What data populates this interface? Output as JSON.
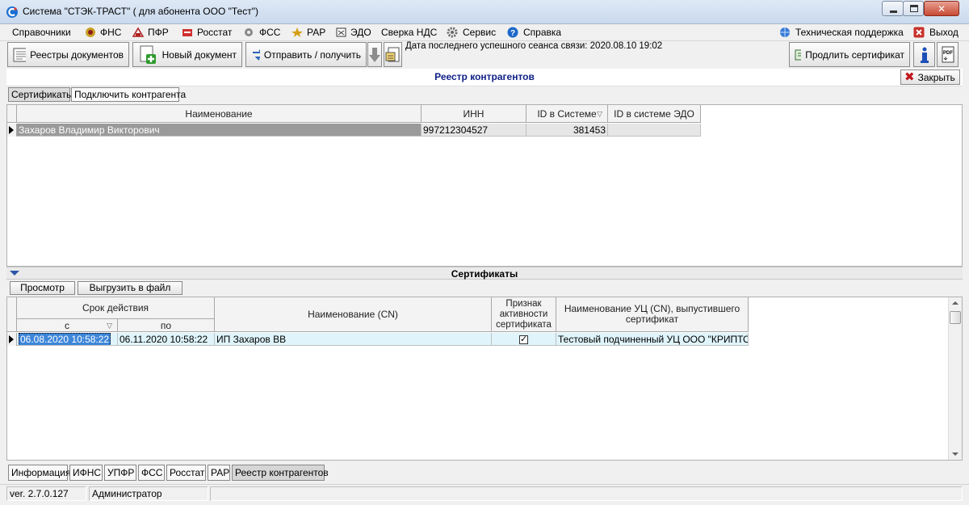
{
  "window": {
    "title": "Система \"СТЭК-ТРАСТ\" ( для абонента ООО \"Тест\")"
  },
  "menu": {
    "items": [
      {
        "label": "Справочники",
        "icon": "none"
      },
      {
        "label": "ФНС",
        "icon": "fns-icon"
      },
      {
        "label": "ПФР",
        "icon": "pfr-icon"
      },
      {
        "label": "Росстат",
        "icon": "rosstat-icon"
      },
      {
        "label": "ФСС",
        "icon": "fss-icon"
      },
      {
        "label": "РАР",
        "icon": "rar-icon"
      },
      {
        "label": "ЭДО",
        "icon": "edo-icon"
      },
      {
        "label": "Сверка НДС",
        "icon": "none"
      },
      {
        "label": "Сервис",
        "icon": "gear-icon"
      },
      {
        "label": "Справка",
        "icon": "help-icon"
      }
    ],
    "support": "Техническая поддержка",
    "exit": "Выход"
  },
  "toolbar": {
    "registry_label": "Реестры документов",
    "new_doc_label": "Новый документ",
    "send_receive_label": "Отправить / получить",
    "last_session": "Дата последнего успешного сеанса связи: 2020.08.10 19:02",
    "renew_cert_label": "Продлить сертификат"
  },
  "section": {
    "title": "Реестр контрагентов",
    "close_label": "Закрыть"
  },
  "subtabs": [
    "Сертификаты",
    "Подключить контрагента"
  ],
  "contractors": {
    "columns": [
      "Наименование",
      "ИНН",
      "ID в Системе",
      "ID в системе ЭДО"
    ],
    "rows": [
      {
        "name": "Захаров Владимир Викторович",
        "inn": "997212304527",
        "system_id": "381453",
        "edo_id": ""
      }
    ]
  },
  "certificates": {
    "title": "Сертификаты",
    "view_label": "Просмотр",
    "export_label": "Выгрузить в файл",
    "columns": {
      "validity": "Срок действия",
      "from": "с",
      "to": "по",
      "cn": "Наименование (CN)",
      "active": "Признак активности сертификата",
      "issuer": "Наименование УЦ (CN), выпустившего сертификат"
    },
    "rows": [
      {
        "from": "06.08.2020 10:58:22",
        "to": "06.11.2020 10:58:22",
        "cn": "ИП Захаров ВВ",
        "active": true,
        "issuer": "Тестовый подчиненный УЦ ООО \"КРИПТО-..."
      }
    ]
  },
  "bottom_tabs": [
    "Информация",
    "ИФНС",
    "УПФР",
    "ФСС",
    "Росстат",
    "РАР",
    "Реестр контрагентов"
  ],
  "status": {
    "version": "ver. 2.7.0.127",
    "user": "Администратор"
  }
}
